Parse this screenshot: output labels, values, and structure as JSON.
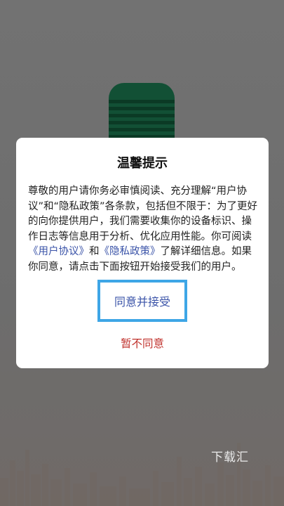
{
  "background": {
    "watermark": "下载汇"
  },
  "dialog": {
    "title": "温馨提示",
    "body": {
      "part1": "尊敬的用户请你务必审慎阅读、充分理解“用户协议”和“隐私政策”各条款，包括但不限于：为了更好的向你提供用户，我们需要收集你的设备标识、操作日志等信息用于分析、优化应用性能。你可阅读",
      "link_user_agreement": "《用户协议》",
      "part2": "和",
      "link_privacy_policy": "《隐私政策》",
      "part3": "了解详细信息。如果你同意，请点击下面按钮开始接受我们的用户。"
    },
    "agree_label": "同意并接受",
    "disagree_label": "暂不同意"
  },
  "colors": {
    "logo_green": "#14573a",
    "link_blue": "#3a53a8",
    "focus_border": "#3ea6e6",
    "decline_red": "#c0312c"
  }
}
